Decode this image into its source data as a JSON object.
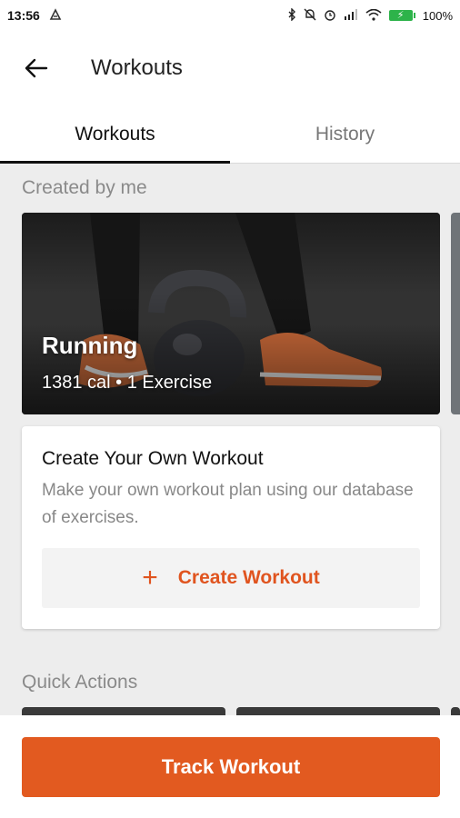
{
  "status_bar": {
    "time": "13:56",
    "battery_percent": "100%",
    "icons": [
      "notification-icon",
      "bluetooth-icon",
      "mute-icon",
      "alarm-icon",
      "signal-icon",
      "wifi-icon",
      "battery-icon"
    ]
  },
  "app_bar": {
    "title": "Workouts",
    "back_icon": "arrow-left-icon"
  },
  "tabs": [
    {
      "label": "Workouts",
      "active": true
    },
    {
      "label": "History",
      "active": false
    }
  ],
  "sections": {
    "created_by_me": "Created by me",
    "quick_actions": "Quick Actions"
  },
  "workout_card": {
    "title": "Running",
    "subtitle": "1381 cal • 1 Exercise"
  },
  "create_card": {
    "heading": "Create Your Own Workout",
    "description": "Make your own workout plan using our database of exercises.",
    "button_label": "Create Workout",
    "button_icon": "plus-icon"
  },
  "bottom": {
    "track_button": "Track Workout"
  },
  "colors": {
    "accent": "#e25a20",
    "background": "#ededed"
  }
}
